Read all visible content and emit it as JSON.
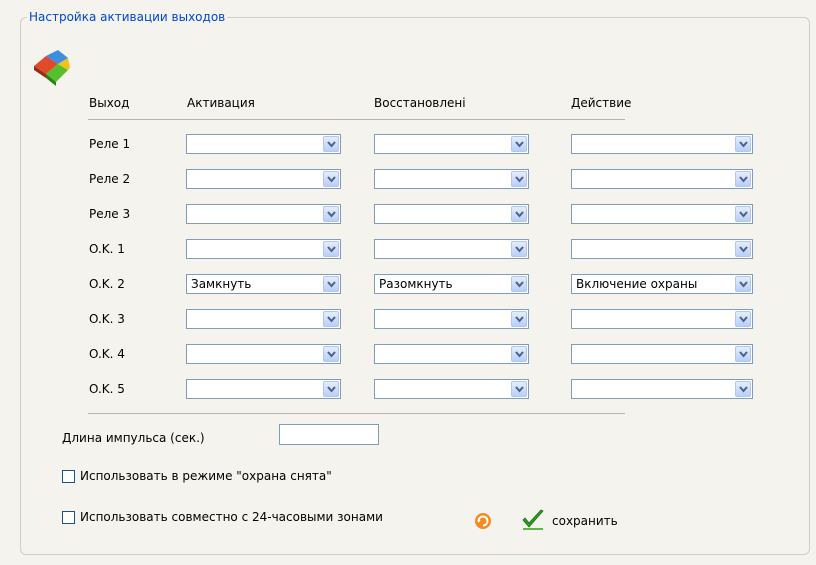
{
  "group_title": "Настройка активации выходов",
  "headers": {
    "output": "Выход",
    "activation": "Активация",
    "restore": "Восстановлені",
    "action": "Действие"
  },
  "rows": [
    {
      "label": "Реле 1",
      "activation": "",
      "restore": "",
      "action": ""
    },
    {
      "label": "Реле 2",
      "activation": "",
      "restore": "",
      "action": ""
    },
    {
      "label": "Реле 3",
      "activation": "",
      "restore": "",
      "action": ""
    },
    {
      "label": "O.K. 1",
      "activation": "",
      "restore": "",
      "action": ""
    },
    {
      "label": "O.K. 2",
      "activation": "Замкнуть",
      "restore": "Разомкнуть",
      "action": "Включение охраны"
    },
    {
      "label": "O.K. 3",
      "activation": "",
      "restore": "",
      "action": ""
    },
    {
      "label": "O.K. 4",
      "activation": "",
      "restore": "",
      "action": ""
    },
    {
      "label": "O.K. 5",
      "activation": "",
      "restore": "",
      "action": ""
    }
  ],
  "pulse_length": {
    "label": "Длина импульса (сек.)",
    "value": ""
  },
  "options": {
    "disarmed_mode": {
      "label": "Использовать в режиме \"охрана снята\"",
      "checked": false
    },
    "with_24h_zones": {
      "label": "Использовать совместно с 24-часовыми зонами",
      "checked": false
    }
  },
  "actions": {
    "save_label": "сохранить",
    "refresh_icon": "refresh-icon",
    "save_icon": "checkmark-icon"
  },
  "colors": {
    "legend": "#0046d5",
    "combo_border": "#7f9db9",
    "panel_bg": "#f4f3ee"
  }
}
